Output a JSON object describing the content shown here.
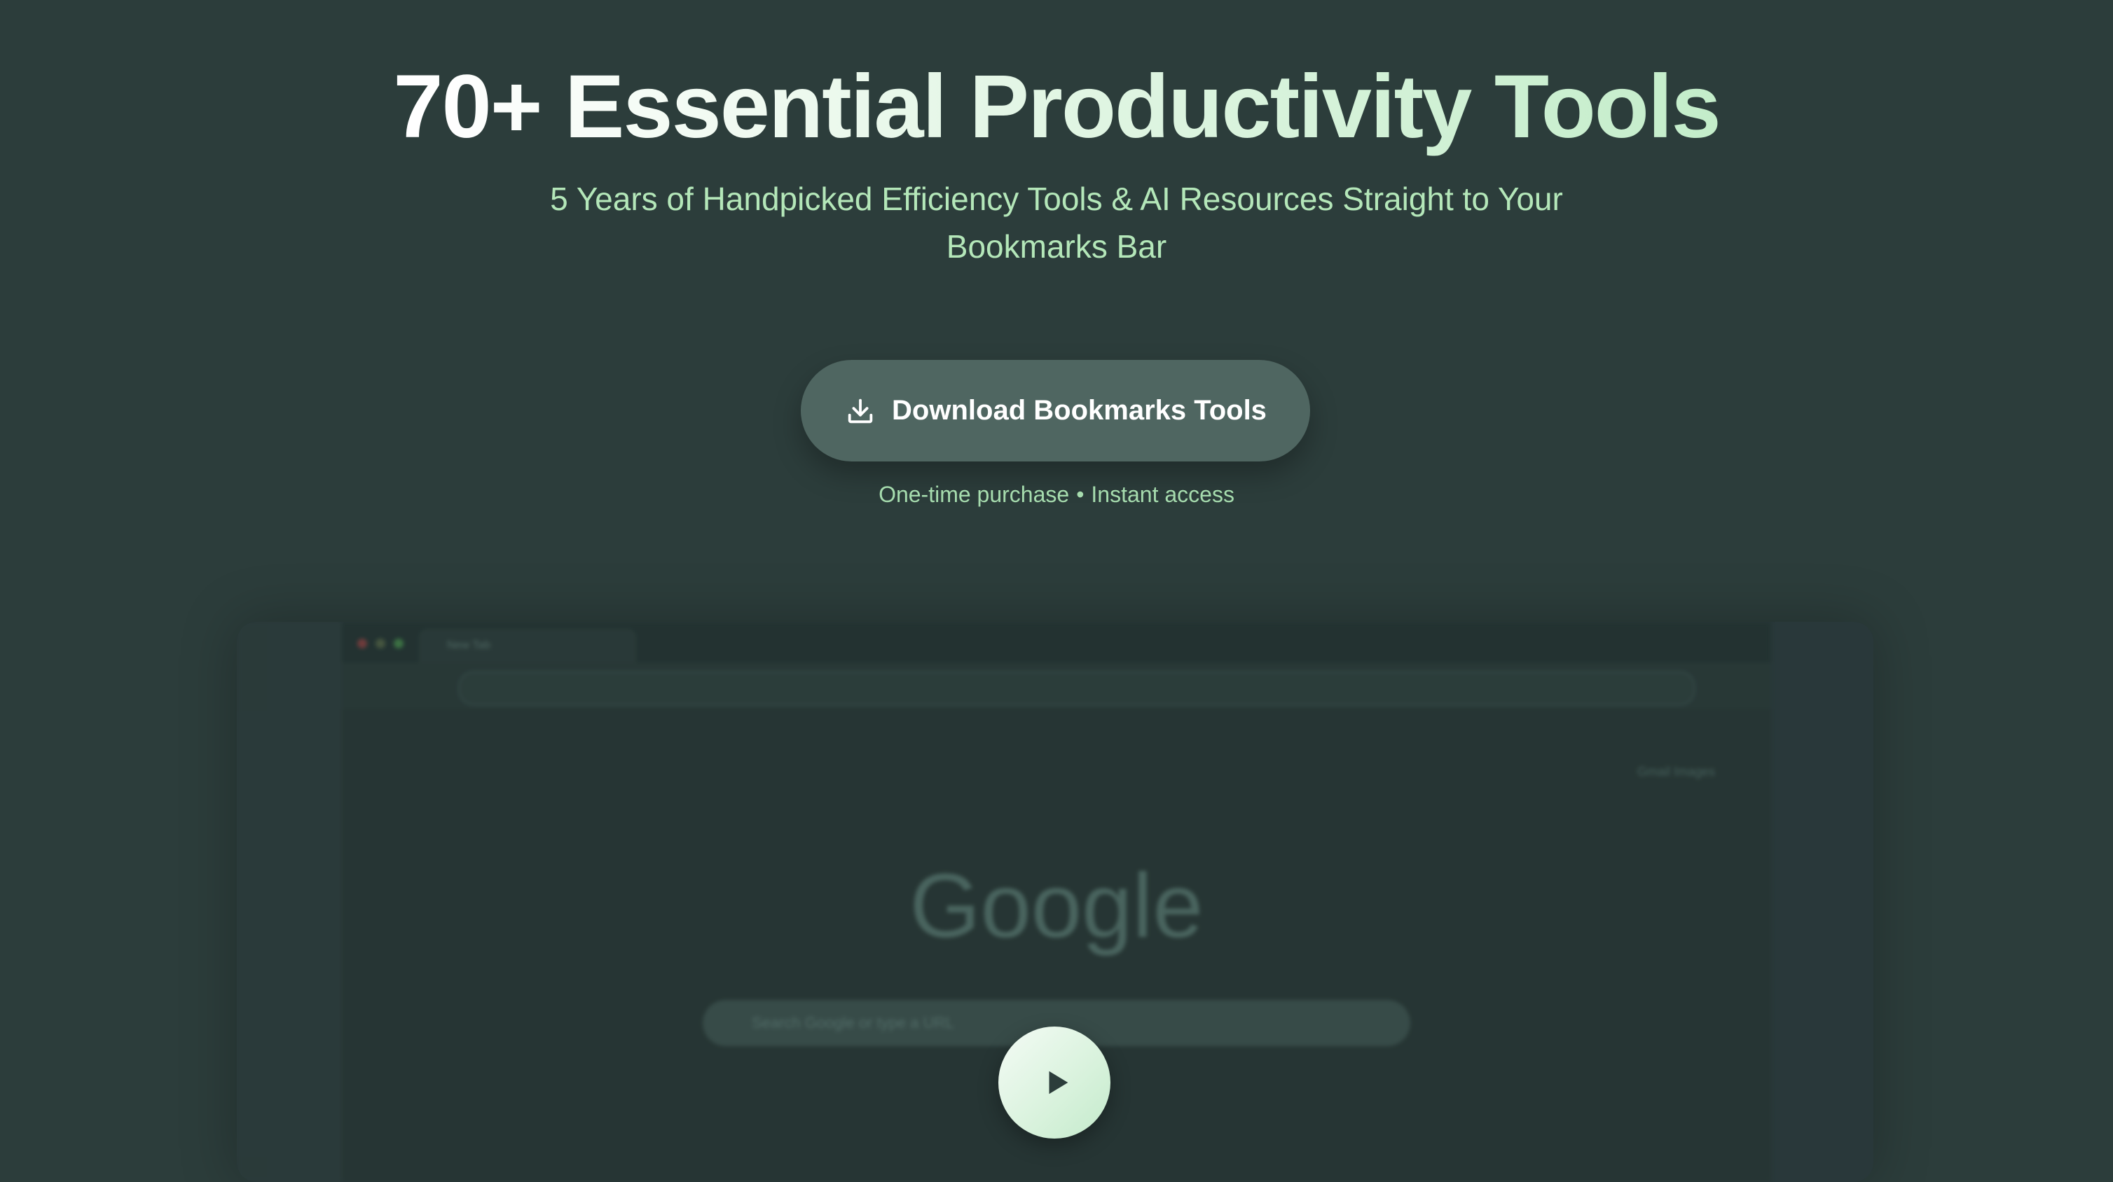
{
  "hero": {
    "title": "70+ Essential Productivity Tools",
    "subtitle": "5 Years of Handpicked Efficiency Tools & AI Resources Straight to Your Bookmarks Bar"
  },
  "cta": {
    "label": "Download Bookmarks Tools",
    "icon": "download-icon",
    "note_left": "One-time purchase",
    "note_separator": "•",
    "note_right": "Instant access"
  },
  "preview": {
    "tab_title": "New Tab",
    "google_logo": "Google",
    "search_placeholder": "Search Google or type a URL",
    "top_links": "Gmail  Images"
  },
  "video": {
    "play_icon": "play-icon"
  },
  "colors": {
    "background": "#2c3d3b",
    "accent_text": "#b4e7b9",
    "button_bg": "#4f6661"
  }
}
